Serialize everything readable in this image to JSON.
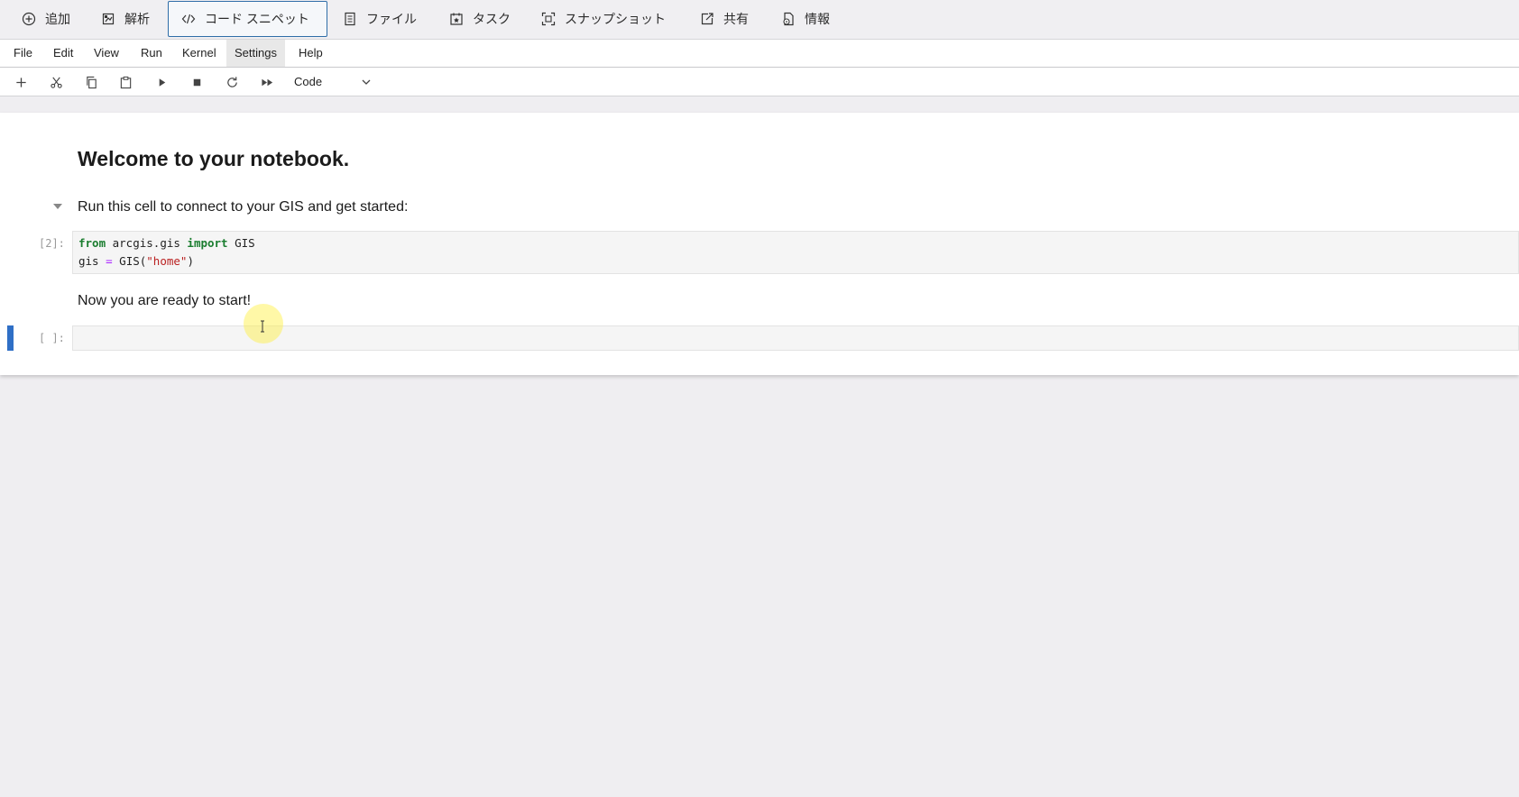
{
  "app_toolbar": {
    "items": [
      {
        "label": "追加",
        "icon": "plus-circle-icon"
      },
      {
        "label": "解析",
        "icon": "analysis-icon"
      },
      {
        "label": "コード スニペット",
        "icon": "code-icon"
      },
      {
        "label": "ファイル",
        "icon": "file-icon"
      },
      {
        "label": "タスク",
        "icon": "task-icon"
      },
      {
        "label": "スナップショット",
        "icon": "snapshot-icon"
      },
      {
        "label": "共有",
        "icon": "share-icon"
      },
      {
        "label": "情報",
        "icon": "info-icon"
      }
    ],
    "active_index": 2
  },
  "menubar": {
    "items": [
      "File",
      "Edit",
      "View",
      "Run",
      "Kernel",
      "Settings",
      "Help"
    ],
    "hover_index": 5
  },
  "nb_toolbar": {
    "tools": [
      "add-cell-icon",
      "cut-icon",
      "copy-icon",
      "paste-icon",
      "run-icon",
      "stop-icon",
      "restart-icon",
      "fast-forward-icon"
    ],
    "cell_type": "Code"
  },
  "notebook": {
    "heading": "Welcome to your notebook.",
    "intro": "Run this cell to connect to your GIS and get started:",
    "code_prompt": "[2]:",
    "code": {
      "line1": {
        "kw1": "from",
        "mod": " arcgis.gis ",
        "kw2": "import",
        "name": " GIS"
      },
      "line2": {
        "var": "gis ",
        "op": "=",
        "call": " GIS(",
        "str": "\"home\"",
        "close": ")"
      }
    },
    "ready": "Now you are ready to start!",
    "empty_prompt": "[ ]:"
  },
  "colors": {
    "accent": "#2f6da8",
    "active_cell_bar": "#2f6fc6",
    "keyword": "#1a7d2f",
    "string": "#ba2121"
  }
}
